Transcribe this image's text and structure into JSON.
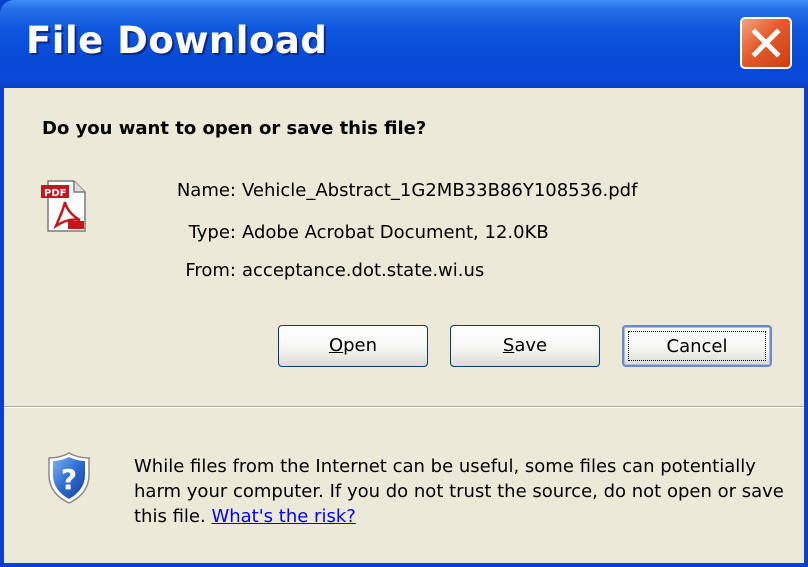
{
  "window": {
    "title": "File Download",
    "close_label": "Close"
  },
  "dialog": {
    "question": "Do you want to open or save this file?",
    "file_icon": "pdf-file-icon",
    "fields": [
      {
        "label": "Name:",
        "value": "Vehicle_Abstract_1G2MB33B86Y108536.pdf"
      },
      {
        "label": "Type:",
        "value": "Adobe Acrobat Document, 12.0KB"
      },
      {
        "label": "From:",
        "value": "acceptance.dot.state.wi.us"
      }
    ],
    "buttons": {
      "open_prefix": "",
      "open_accel": "O",
      "open_rest": "pen",
      "save_prefix": "",
      "save_accel": "S",
      "save_rest": "ave",
      "cancel": "Cancel"
    }
  },
  "warning": {
    "icon": "security-shield-question-icon",
    "text": "While files from the Internet can be useful, some files can potentially harm your computer. If you do not trust the source, do not open or save this file.",
    "link": "What's the risk?"
  },
  "colors": {
    "titlebar": "#0a4ad8",
    "client_bg": "#ece9d8",
    "close": "#e35b2c",
    "link": "#0000ee"
  }
}
